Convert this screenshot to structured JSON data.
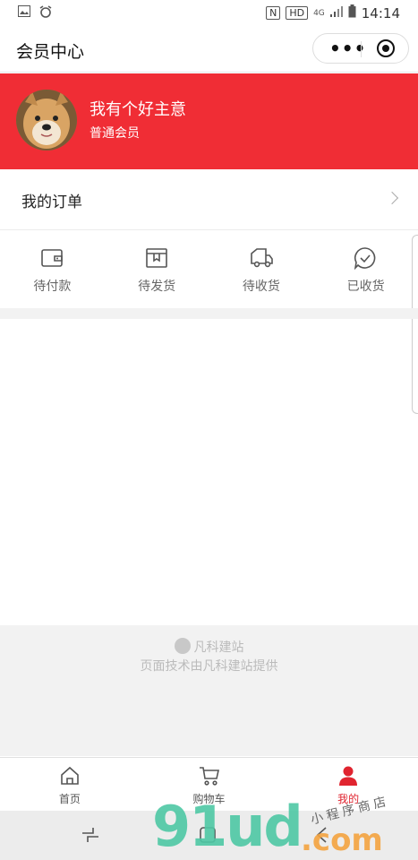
{
  "statusbar": {
    "time": "14:14",
    "network": "4G",
    "hd": "HD",
    "nfc": "N"
  },
  "navbar": {
    "title": "会员中心",
    "more_label": "•••"
  },
  "profile": {
    "nickname": "我有个好主意",
    "level": "普通会员"
  },
  "orders": {
    "title": "我的订单",
    "statuses": [
      {
        "label": "待付款",
        "icon": "wallet-icon"
      },
      {
        "label": "待发货",
        "icon": "package-icon"
      },
      {
        "label": "待收货",
        "icon": "truck-icon"
      },
      {
        "label": "已收货",
        "icon": "check-chat-icon"
      }
    ]
  },
  "footer": {
    "brand": "凡科建站",
    "powered": "页面技术由凡科建站提供"
  },
  "tabbar": {
    "items": [
      {
        "label": "首页",
        "icon": "home-icon",
        "active": false
      },
      {
        "label": "购物车",
        "icon": "cart-icon",
        "active": false
      },
      {
        "label": "我的",
        "icon": "user-icon",
        "active": true
      }
    ]
  },
  "watermark": {
    "main": "91ud",
    "suffix": ".com",
    "tagline": "小程序商店"
  },
  "colors": {
    "accent": "#f02d35",
    "tab_active": "#e0242f",
    "watermark_green": "#4ec8a5",
    "watermark_orange": "#f4a340"
  }
}
